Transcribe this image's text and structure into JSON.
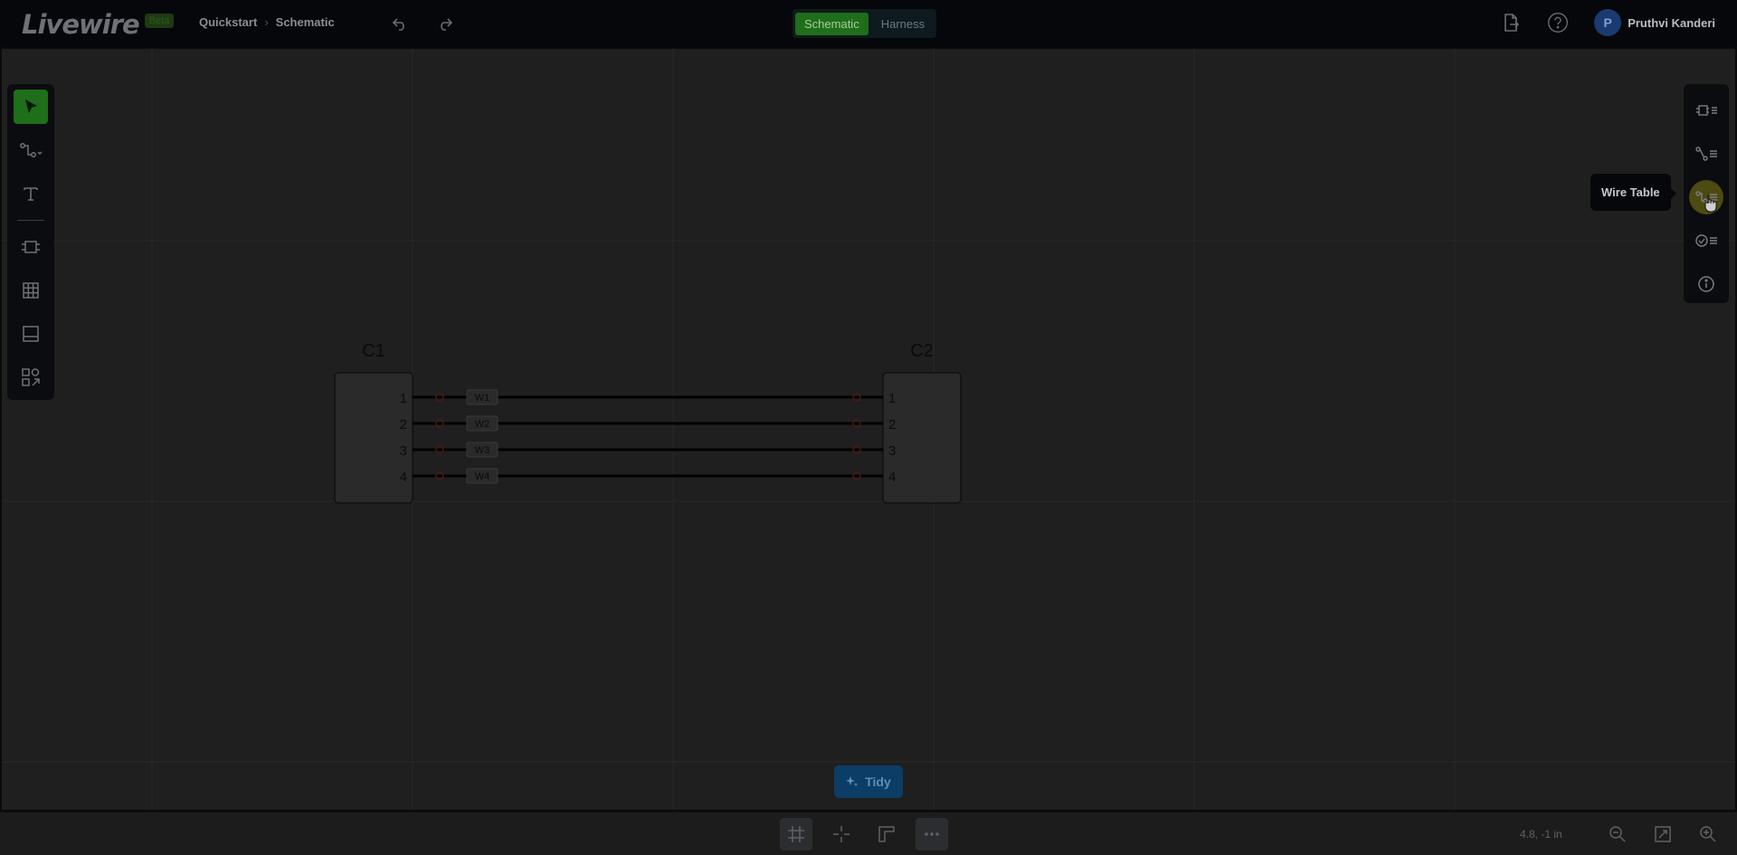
{
  "app": {
    "logo": "Livewire",
    "badge": "Beta"
  },
  "breadcrumb": {
    "project": "Quickstart",
    "page": "Schematic"
  },
  "modes": [
    {
      "label": "Schematic",
      "active": true
    },
    {
      "label": "Harness",
      "active": false
    }
  ],
  "user": {
    "initial": "P",
    "name": "Pruthvi Kanderi"
  },
  "left_tools": [
    {
      "name": "select-tool",
      "icon": "cursor-icon",
      "active": true
    },
    {
      "name": "wire-tool",
      "icon": "wire-icon"
    },
    {
      "name": "text-tool",
      "icon": "text-icon"
    },
    {
      "name": "connector-tool",
      "icon": "connector-icon"
    },
    {
      "name": "table-tool",
      "icon": "table-icon"
    },
    {
      "name": "titleblock-tool",
      "icon": "titleblock-icon"
    },
    {
      "name": "components-tool",
      "icon": "shapes-icon"
    }
  ],
  "right_tools": [
    {
      "name": "connector-table",
      "icon": "connector-list-icon"
    },
    {
      "name": "cable-table",
      "icon": "cable-list-icon"
    },
    {
      "name": "wire-table",
      "icon": "wire-list-icon",
      "hover": true
    },
    {
      "name": "checks",
      "icon": "check-list-icon"
    },
    {
      "name": "info",
      "icon": "info-icon"
    }
  ],
  "tooltip": {
    "text": "Wire Table"
  },
  "schematic": {
    "connectors": [
      {
        "label": "C1",
        "pins": [
          "1",
          "2",
          "3",
          "4"
        ]
      },
      {
        "label": "C2",
        "pins": [
          "1",
          "2",
          "3",
          "4"
        ]
      }
    ],
    "wires": [
      "W1",
      "W2",
      "W3",
      "W4"
    ]
  },
  "tidy": {
    "label": "Tidy"
  },
  "status": {
    "coordinates": "4.8, -1 in"
  }
}
